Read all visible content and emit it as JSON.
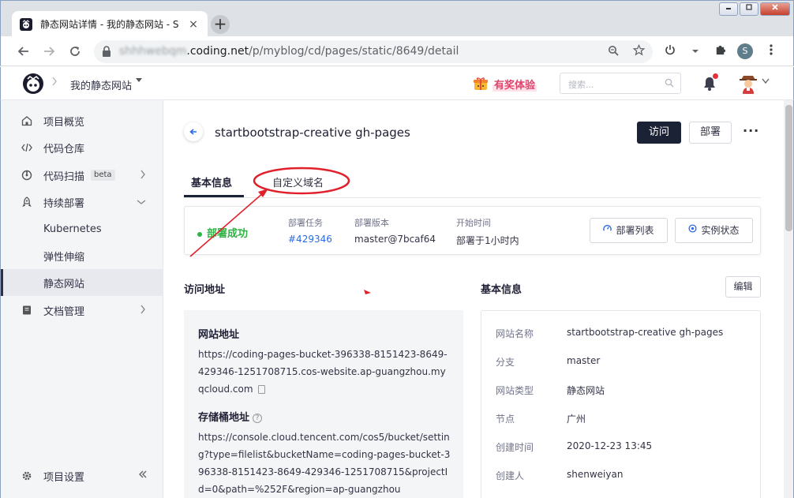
{
  "browser": {
    "tab_title": "静态网站详情 - 我的静态网站 - S",
    "tab_close": "×",
    "new_tab": "+",
    "url_host_blurred": "shhhwebqm",
    "url_host": ".coding.net",
    "url_path": "/p/myblog/cd/pages/static/8649/detail",
    "profile_initial": "S"
  },
  "header": {
    "project_name": "我的静态网站",
    "promo": "有奖体验",
    "search_placeholder": "搜索..."
  },
  "sidebar": {
    "items": [
      {
        "label": "项目概览"
      },
      {
        "label": "代码仓库"
      },
      {
        "label": "代码扫描",
        "badge": "beta"
      },
      {
        "label": "持续部署"
      },
      {
        "label": "Kubernetes"
      },
      {
        "label": "弹性伸缩"
      },
      {
        "label": "静态网站"
      },
      {
        "label": "文档管理"
      }
    ],
    "settings": "项目设置"
  },
  "page": {
    "title": "startbootstrap-creative gh-pages",
    "visit_button": "访问",
    "deploy_button": "部署",
    "more": "···",
    "tabs": [
      "基本信息",
      "自定义域名"
    ]
  },
  "deploy": {
    "status": "部署成功",
    "task_label": "部署任务",
    "task_value": "#429346",
    "version_label": "部署版本",
    "version_value": "master@7bcaf64",
    "start_label": "开始时间",
    "start_value": "部署于1小时内",
    "list_button": "部署列表",
    "instance_button": "实例状态"
  },
  "access": {
    "section_title": "访问地址",
    "site_url_label": "网站地址",
    "site_url": "https://coding-pages-bucket-396338-8151423-8649-429346-1251708715.cos-website.ap-guangzhou.myqcloud.com",
    "bucket_label": "存储桶地址",
    "bucket_url": "https://console.cloud.tencent.com/cos5/bucket/setting?type=filelist&bucketName=coding-pages-bucket-396338-8151423-8649-429346-1251708715&projectId=0&path=%252F&region=ap-guangzhou"
  },
  "info": {
    "section_title": "基本信息",
    "edit_button": "编辑",
    "rows": [
      {
        "k": "网站名称",
        "v": "startbootstrap-creative gh-pages"
      },
      {
        "k": "分支",
        "v": "master"
      },
      {
        "k": "网站类型",
        "v": "静态网站"
      },
      {
        "k": "节点",
        "v": "广州"
      },
      {
        "k": "创建时间",
        "v": "2020-12-23 13:45"
      },
      {
        "k": "创建人",
        "v": "shenweiyan"
      }
    ]
  },
  "colors": {
    "annotation": "#e0202a",
    "success": "#2fb344",
    "link": "#2b6be3",
    "primary_button": "#1b2236"
  }
}
